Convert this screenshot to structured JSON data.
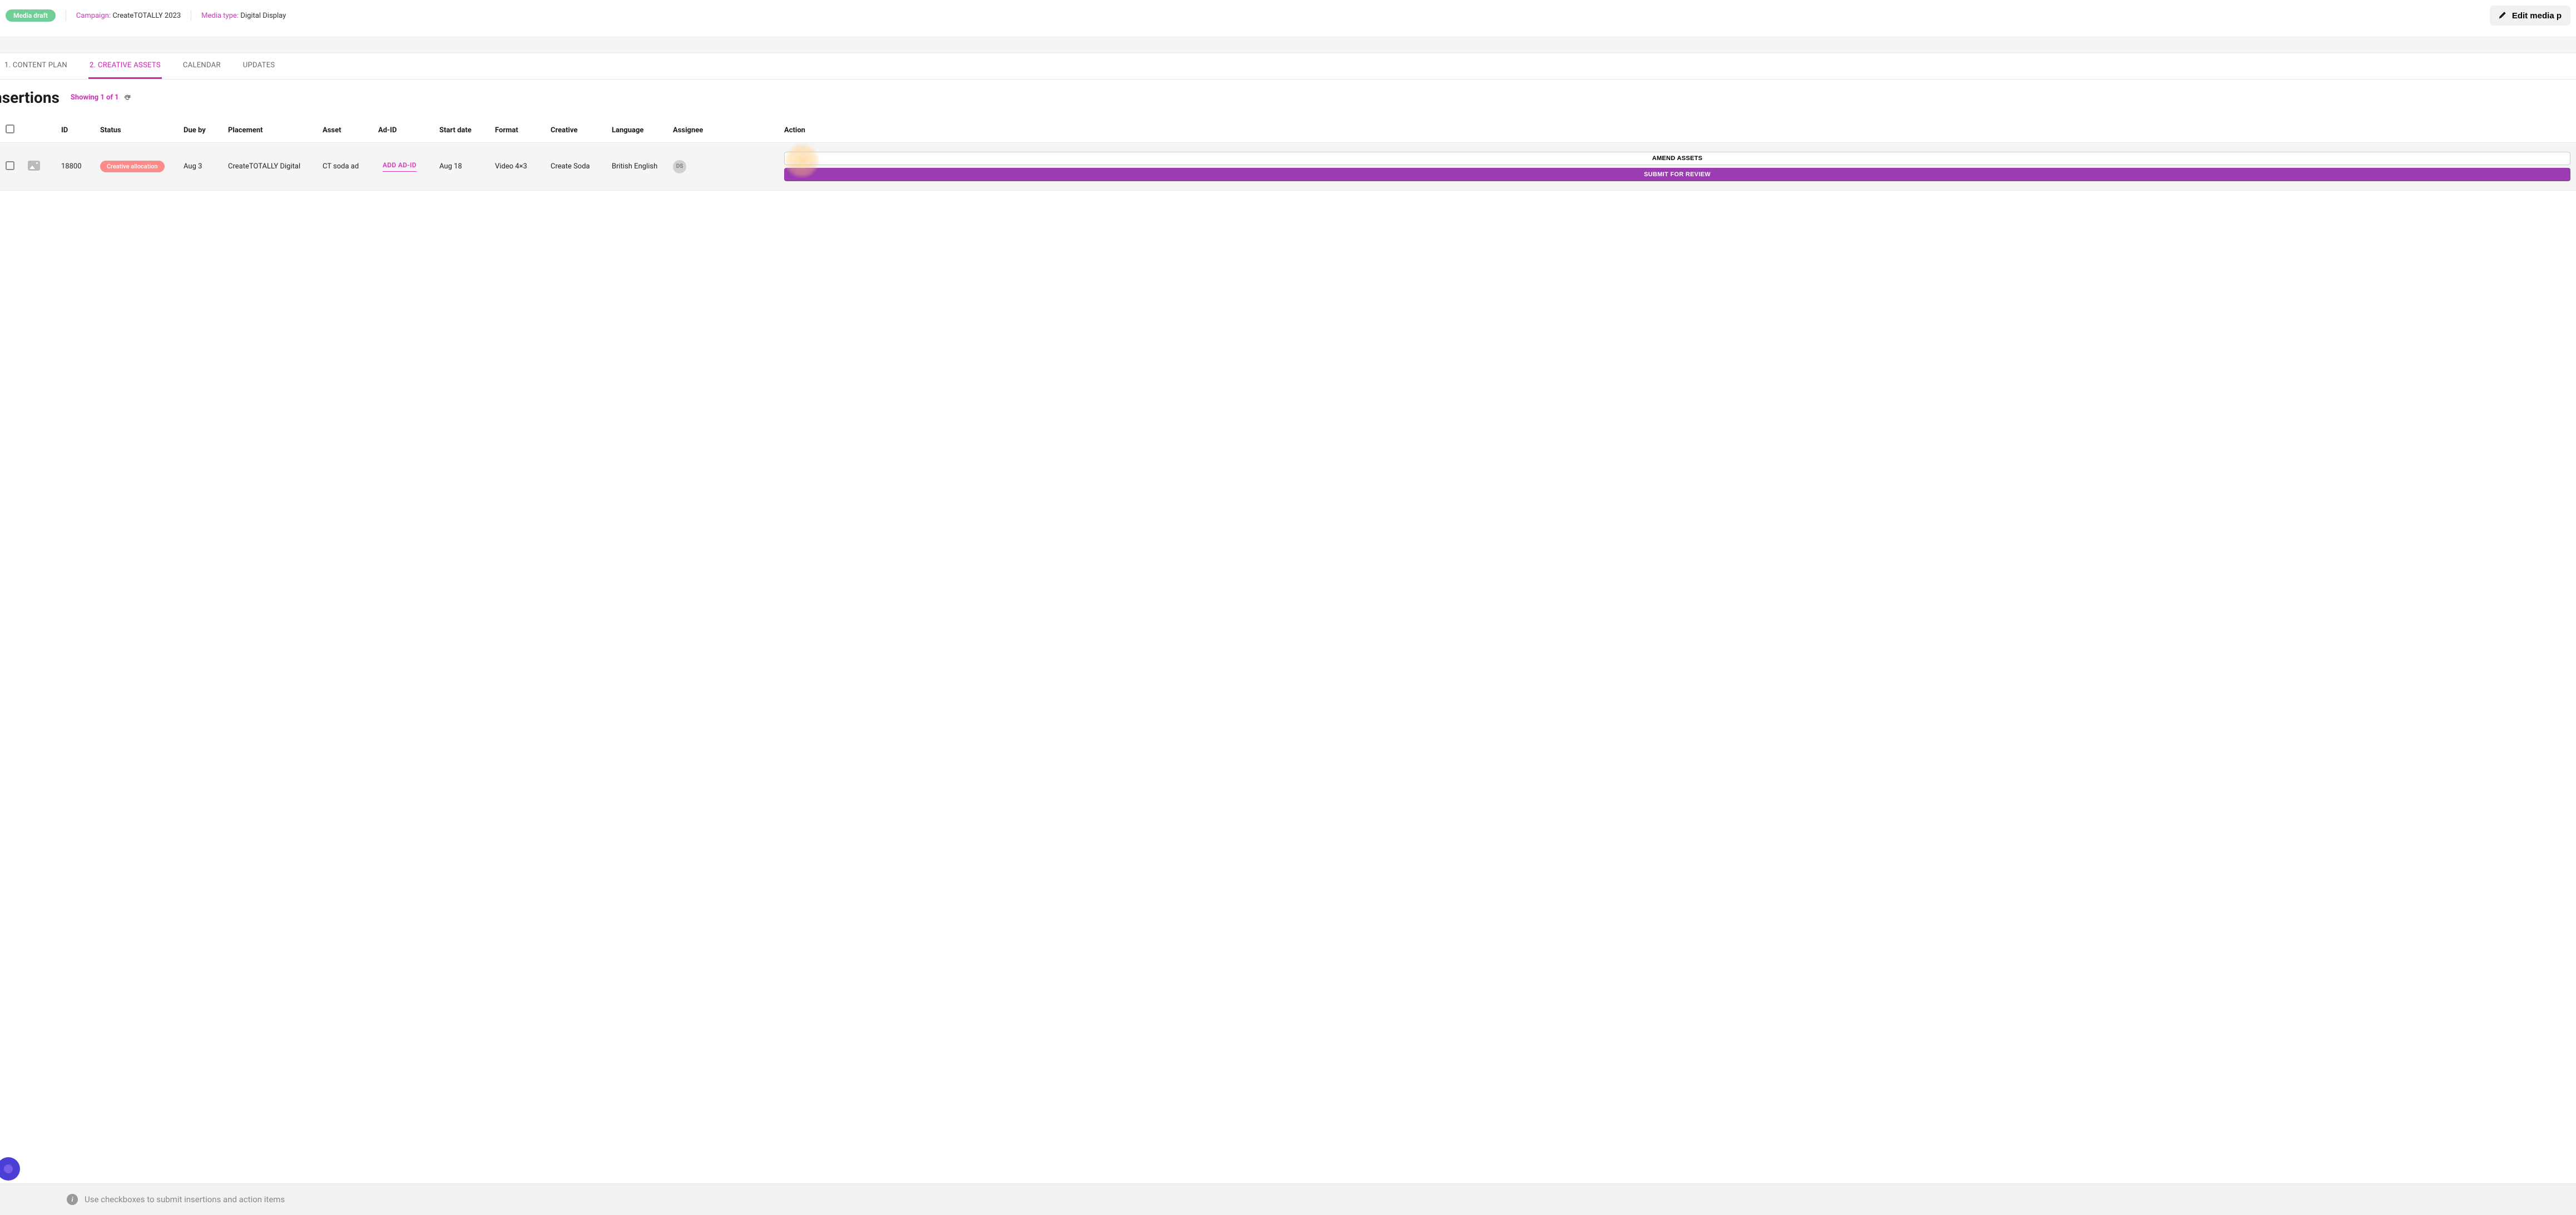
{
  "header": {
    "badge": "Media draft",
    "campaign_label": "Campaign:",
    "campaign_value": "CreateTOTALLY 2023",
    "mediatype_label": "Media type:",
    "mediatype_value": "Digital Display",
    "edit_button": "Edit media p"
  },
  "tabs": [
    {
      "label": "1. CONTENT PLAN",
      "active": false
    },
    {
      "label": "2. CREATIVE ASSETS",
      "active": true
    },
    {
      "label": "CALENDAR",
      "active": false
    },
    {
      "label": "UPDATES",
      "active": false
    }
  ],
  "title": "nsertions",
  "showing": "Showing 1 of 1",
  "columns": {
    "id": "ID",
    "status": "Status",
    "due": "Due by",
    "placement": "Placement",
    "asset": "Asset",
    "adid": "Ad-ID",
    "start": "Start date",
    "format": "Format",
    "creative": "Creative",
    "language": "Language",
    "assignee": "Assignee",
    "action": "Action"
  },
  "row": {
    "id": "18800",
    "status": "Creative allocation",
    "due": "Aug 3",
    "placement": "CreateTOTALLY Digital",
    "asset": "CT soda ad",
    "adid_action": "ADD AD-ID",
    "start": "Aug 18",
    "format": "Video 4×3",
    "creative": "Create Soda",
    "language": "British English",
    "assignee_initials": "DS",
    "amend_label": "AMEND ASSETS",
    "submit_label": "SUBMIT FOR REVIEW"
  },
  "footer": {
    "hint": "Use checkboxes to submit insertions and action items"
  }
}
